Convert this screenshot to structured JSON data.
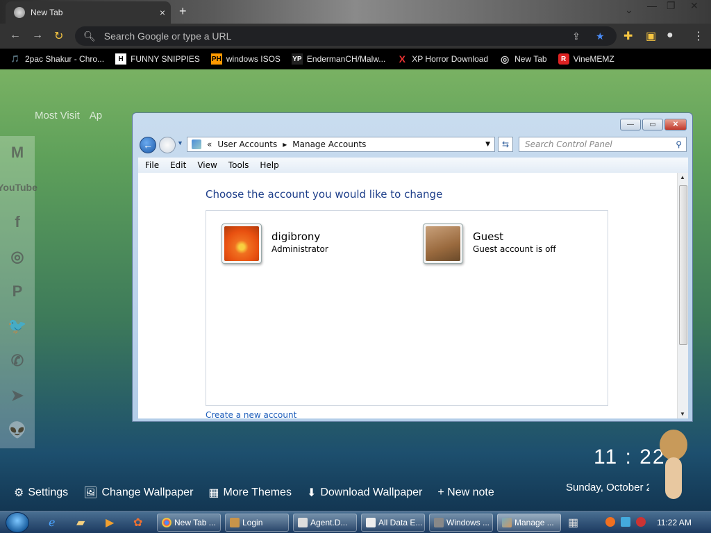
{
  "browser": {
    "tab_title": "New Tab",
    "tab_close": "×",
    "new_tab": "+",
    "omnibox_placeholder": "Search Google or type a URL",
    "bookmarks": [
      {
        "label": "2pac Shakur - Chro...",
        "icon": "🎵"
      },
      {
        "label": "FUNNY SNIPPIES",
        "icon": "H"
      },
      {
        "label": "windows ISOS",
        "icon": "PH"
      },
      {
        "label": "EndermanCH/Malw...",
        "icon": "YP"
      },
      {
        "label": "XP Horror Download",
        "icon": "X"
      },
      {
        "label": "New Tab",
        "icon": "◎"
      },
      {
        "label": "VineMEMZ",
        "icon": "R"
      }
    ]
  },
  "ntp": {
    "most_visited": "Most Visit",
    "apps": "Ap",
    "settings": "Settings",
    "change_wallpaper": "Change Wallpaper",
    "more_themes": "More Themes",
    "download_wallpaper": "Download Wallpaper",
    "new_note": "+ New note",
    "clock": "11 : 22",
    "date": "Sunday, October 2",
    "social": [
      "M",
      "YouTube",
      "f",
      "◎",
      "P",
      "🐦",
      "✆",
      "➤",
      "👽"
    ]
  },
  "window": {
    "breadcrumb_prefix": "«",
    "crumb1": "User Accounts",
    "crumb_sep": "▸",
    "crumb2": "Manage Accounts",
    "search_placeholder": "Search Control Panel",
    "menu": [
      "File",
      "Edit",
      "View",
      "Tools",
      "Help"
    ],
    "heading": "Choose the account you would like to change",
    "accounts": [
      {
        "name": "digibrony",
        "role": "Administrator"
      },
      {
        "name": "Guest",
        "role": "Guest account is off"
      }
    ],
    "create_link": "Create a new account"
  },
  "taskbar": {
    "buttons": [
      "New Tab ...",
      "Login",
      "Agent.D...",
      "All Data E...",
      "Windows ...",
      "Manage ..."
    ],
    "time": "11:22 AM"
  }
}
